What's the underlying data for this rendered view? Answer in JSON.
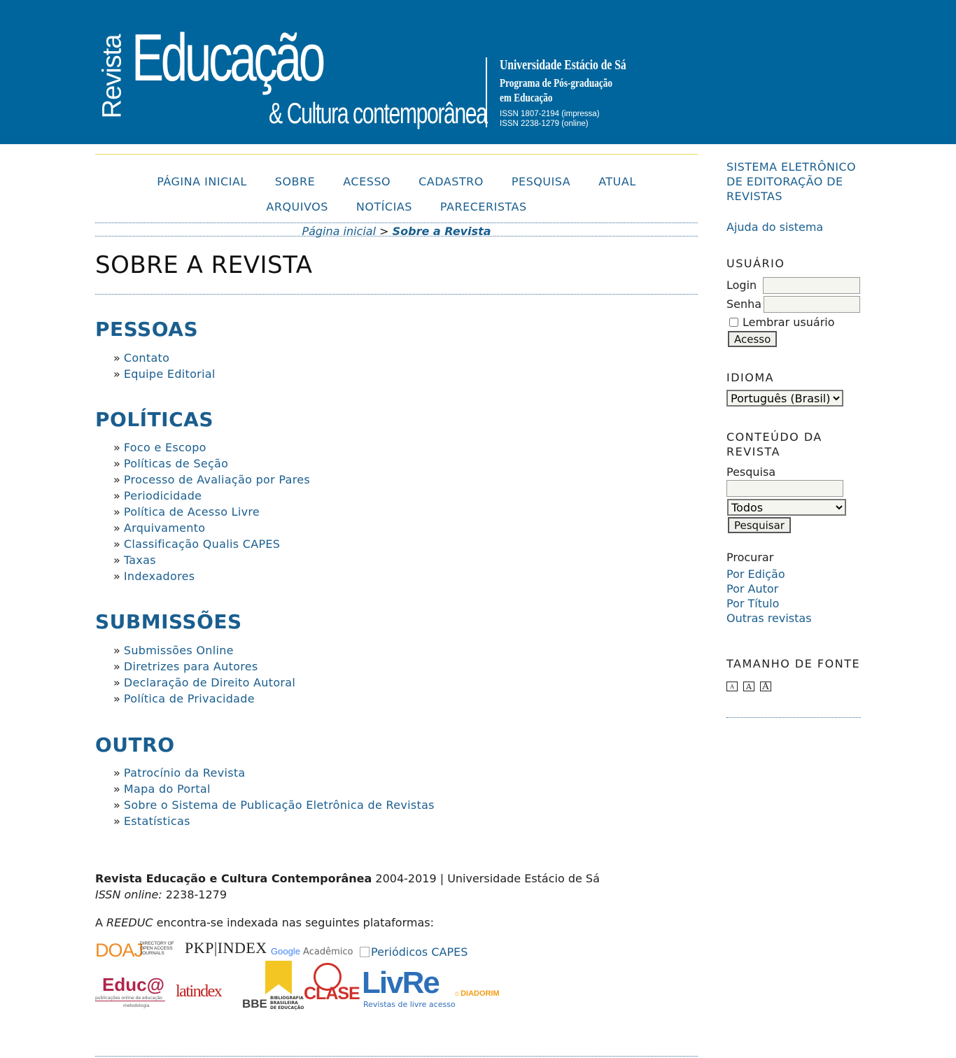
{
  "header": {
    "logo_revista": "Revista",
    "logo_educacao": "Educação",
    "logo_cultura": "& Cultura contemporânea",
    "university": "Universidade Estácio de Sá",
    "program_line1": "Programa de Pós-graduação",
    "program_line2": "em Educação",
    "issn_print": "ISSN 1807-2194 (impressa)",
    "issn_online": "ISSN 2238-1279 (online)"
  },
  "nav": {
    "items": [
      "PÁGINA INICIAL",
      "SOBRE",
      "ACESSO",
      "CADASTRO",
      "PESQUISA",
      "ATUAL",
      "ARQUIVOS",
      "NOTÍCIAS",
      "PARECERISTAS"
    ]
  },
  "breadcrumb": {
    "home": "Página inicial",
    "separator": ">",
    "current": "Sobre a Revista"
  },
  "page_title": "SOBRE A REVISTA",
  "sections": [
    {
      "title": "PESSOAS",
      "links": [
        "Contato",
        "Equipe Editorial"
      ]
    },
    {
      "title": "POLÍTICAS",
      "links": [
        "Foco e Escopo",
        "Políticas de Seção",
        "Processo de Avaliação por Pares",
        "Periodicidade",
        "Política de Acesso Livre",
        "Arquivamento",
        "Classificação Qualis CAPES",
        "Taxas",
        "Indexadores"
      ]
    },
    {
      "title": "SUBMISSÕES",
      "links": [
        "Submissões Online",
        "Diretrizes para Autores",
        "Declaração de Direito Autoral",
        "Política de Privacidade"
      ]
    },
    {
      "title": "OUTRO",
      "links": [
        "Patrocínio da Revista",
        "Mapa do Portal",
        "Sobre o Sistema de Publicação Eletrônica de Revistas",
        "Estatísticas"
      ]
    }
  ],
  "footer": {
    "journal_name": "Revista Educação e Cultura Contemporânea",
    "years_univ": " 2004-2019 | Universidade Estácio de Sá",
    "issn_label": "ISSN online:",
    "issn_value": " 2238-1279",
    "indexed_prefix": "A ",
    "indexed_name": "REEDUC",
    "indexed_suffix": " encontra-se indexada nas seguintes plataformas:",
    "logos": {
      "doaj": "DOAJ",
      "doaj_sub1": "DIRECTORY OF",
      "doaj_sub2": "OPEN ACCESS",
      "doaj_sub3": "JOURNALS",
      "pkp": "PKP|INDEX",
      "google": "Google",
      "google_suffix": " Acadêmico",
      "capes": "Periódicos CAPES",
      "educa": "Educ@",
      "educa_sub": "publicações online de educação",
      "educa_sub2": "metodologia",
      "latindex": "latindex",
      "bbe": "BBE",
      "bbe_sub1": "BIBLIOGRAFIA",
      "bbe_sub2": "BRASILEIRA",
      "bbe_sub3": "DE EDUCAÇÃO",
      "clase": "CLASE",
      "livre": "LivRe",
      "livre_sub": "Revistas de livre acesso",
      "diadorim": "DIADORIM"
    }
  },
  "sidebar": {
    "system_link": "SISTEMA ELETRÔNICO DE EDITORAÇÃO DE REVISTAS",
    "help_link": "Ajuda do sistema",
    "user_title": "USUÁRIO",
    "login_label": "Login",
    "password_label": "Senha",
    "remember_label": "Lembrar usuário",
    "login_button": "Acesso",
    "language_title": "IDIOMA",
    "language_value": "Português (Brasil)",
    "content_title": "CONTEÚDO DA REVISTA",
    "search_label": "Pesquisa",
    "search_scope": "Todos",
    "search_button": "Pesquisar",
    "browse_label": "Procurar",
    "browse_links": [
      "Por Edição",
      "Por Autor",
      "Por Título",
      "Outras revistas"
    ],
    "font_title": "TAMANHO DE FONTE",
    "font_sizes": [
      "A",
      "A",
      "A"
    ]
  },
  "colors": {
    "header_bg": "#00659c",
    "link": "#1a5e8f",
    "accent_line": "#e6dc5a"
  }
}
